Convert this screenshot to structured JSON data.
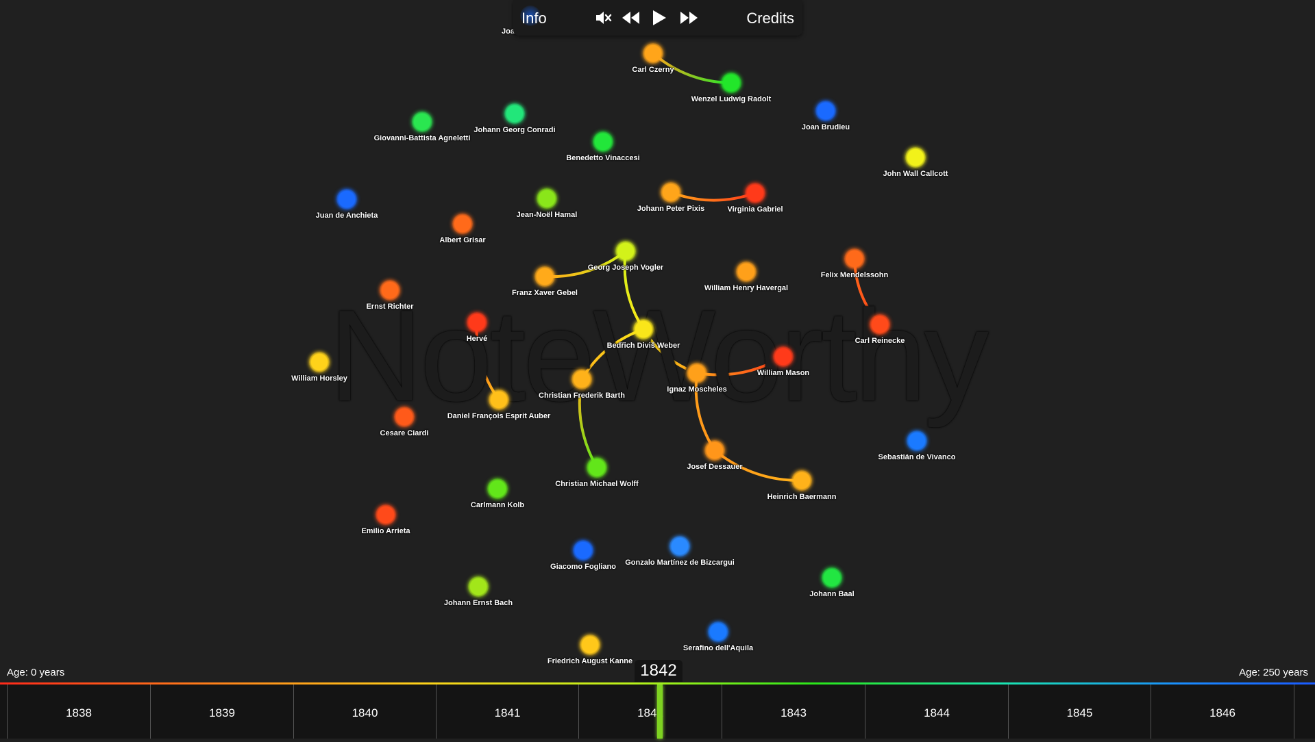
{
  "app": {
    "watermark": "NoteWorthy"
  },
  "topbar": {
    "info_label": "Info",
    "credits_label": "Credits",
    "controls": [
      "mute-icon",
      "rewind-icon",
      "play-icon",
      "fast-forward-icon"
    ]
  },
  "timeline": {
    "age_left": "Age: 0 years",
    "age_right": "Age: 250 years",
    "current_year": "1842",
    "years": [
      "1838",
      "1839",
      "1840",
      "1841",
      "1842",
      "1843",
      "1844",
      "1845",
      "1846"
    ]
  },
  "colors": {
    "background": "#202020",
    "timeline_bg": "#141414",
    "marker": "#7ed321"
  },
  "nodes": [
    {
      "name": "Joachim a Burck",
      "color": "#1a5aff"
    },
    {
      "name": "Carl Czerny",
      "color": "#ffa51a"
    },
    {
      "name": "Wenzel Ludwig Radolt",
      "color": "#22e62a"
    },
    {
      "name": "Joan Brudieu",
      "color": "#1a6aff"
    },
    {
      "name": "Giovanni-Battista Agneletti",
      "color": "#2ae650"
    },
    {
      "name": "Johann Georg Conradi",
      "color": "#22e67a"
    },
    {
      "name": "Benedetto Vinaccesi",
      "color": "#22e63a"
    },
    {
      "name": "John Wall Callcott",
      "color": "#f2f21a"
    },
    {
      "name": "Juan de Anchieta",
      "color": "#1a6aff"
    },
    {
      "name": "Jean-Noël Hamal",
      "color": "#8ae61a"
    },
    {
      "name": "Johann Peter Pixis",
      "color": "#ffa51a"
    },
    {
      "name": "Virginia Gabriel",
      "color": "#ff3a1a"
    },
    {
      "name": "Albert Grisar",
      "color": "#ff6a1a"
    },
    {
      "name": "Georg Joseph Vogler",
      "color": "#d2f21a"
    },
    {
      "name": "Franz Xaver Gebel",
      "color": "#ffaa1a"
    },
    {
      "name": "William Henry Havergal",
      "color": "#ffa01a"
    },
    {
      "name": "Felix Mendelssohn",
      "color": "#ff6a1a"
    },
    {
      "name": "Ernst Richter",
      "color": "#ff6a1a"
    },
    {
      "name": "Hervé",
      "color": "#ff3a1a"
    },
    {
      "name": "Carl Reinecke",
      "color": "#ff4a1a"
    },
    {
      "name": "Bedřich Diviš Weber",
      "color": "#fae61a"
    },
    {
      "name": "William Horsley",
      "color": "#ffd21a"
    },
    {
      "name": "William Mason",
      "color": "#ff3a1a"
    },
    {
      "name": "Ignaz Moscheles",
      "color": "#ffa01a"
    },
    {
      "name": "Christian Frederik Barth",
      "color": "#ffb21a"
    },
    {
      "name": "Daniel François Esprit Auber",
      "color": "#ffc01a"
    },
    {
      "name": "Cesare Ciardi",
      "color": "#ff5a1a"
    },
    {
      "name": "Sebastián de Vivanco",
      "color": "#1a7aff"
    },
    {
      "name": "Josef Dessauer",
      "color": "#ff961a"
    },
    {
      "name": "Christian Michael Wolff",
      "color": "#62e61a"
    },
    {
      "name": "Heinrich Baermann",
      "color": "#ffb21a"
    },
    {
      "name": "Carlmann Kolb",
      "color": "#62e61a"
    },
    {
      "name": "Emilio Arrieta",
      "color": "#ff4a1a"
    },
    {
      "name": "Giacomo Fogliano",
      "color": "#1a6aff"
    },
    {
      "name": "Gonzalo Martínez de Bizcargui",
      "color": "#2a8aff"
    },
    {
      "name": "Johann Baal",
      "color": "#22e642"
    },
    {
      "name": "Johann Ernst Bach",
      "color": "#a2e61a"
    },
    {
      "name": "Serafino dell'Aquila",
      "color": "#1a7aff"
    },
    {
      "name": "Friedrich August Kanne",
      "color": "#ffc81a"
    }
  ],
  "edges": [
    {
      "from": "Carl Czerny",
      "to": "Wenzel Ludwig Radolt"
    },
    {
      "from": "Johann Peter Pixis",
      "to": "Virginia Gabriel"
    },
    {
      "from": "Franz Xaver Gebel",
      "to": "Georg Joseph Vogler"
    },
    {
      "from": "Georg Joseph Vogler",
      "to": "Bedřich Diviš Weber"
    },
    {
      "from": "Felix Mendelssohn",
      "to": "Carl Reinecke"
    },
    {
      "from": "Hervé",
      "to": "Daniel François Esprit Auber"
    },
    {
      "from": "Bedřich Diviš Weber",
      "to": "Christian Frederik Barth"
    },
    {
      "from": "Bedřich Diviš Weber",
      "to": "Ignaz Moscheles"
    },
    {
      "from": "Ignaz Moscheles",
      "to": "William Mason"
    },
    {
      "from": "Ignaz Moscheles",
      "to": "Josef Dessauer"
    },
    {
      "from": "Christian Frederik Barth",
      "to": "Christian Michael Wolff"
    },
    {
      "from": "Josef Dessauer",
      "to": "Heinrich Baermann"
    }
  ]
}
